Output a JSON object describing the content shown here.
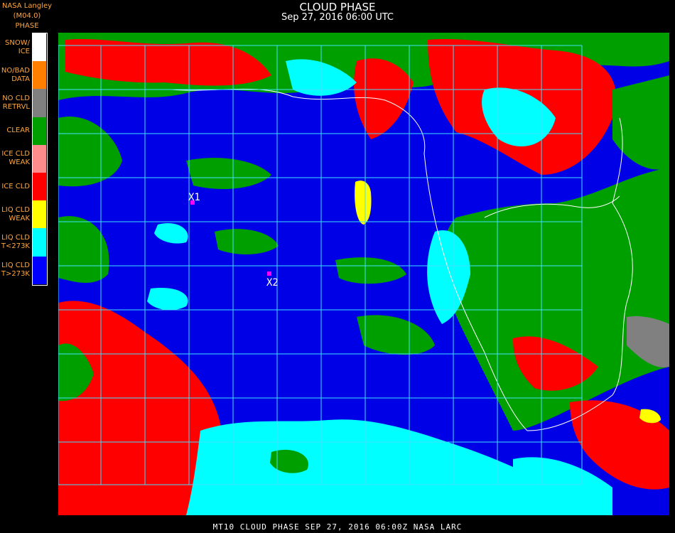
{
  "header": {
    "source": "NASA Langley (M04.0)",
    "legend_title": "PHASE",
    "title": "CLOUD PHASE",
    "subtitle": "Sep 27, 2016 06:00 UTC"
  },
  "legend": [
    {
      "label": "SNOW/\nICE",
      "color": "#ffffff"
    },
    {
      "label": "NO/BAD\nDATA",
      "color": "#ff8000"
    },
    {
      "label": "NO CLD\nRETRVL",
      "color": "#808080"
    },
    {
      "label": "CLEAR",
      "color": "#009f00"
    },
    {
      "label": "ICE CLD\nWEAK",
      "color": "#ff8c8c"
    },
    {
      "label": "ICE CLD",
      "color": "#ff0000"
    },
    {
      "label": "LIQ CLD\nWEAK",
      "color": "#ffff00"
    },
    {
      "label": "LIQ CLD\nT<273K",
      "color": "#00ffff"
    },
    {
      "label": "LIQ CLD\nT>273K",
      "color": "#0000ff"
    }
  ],
  "map": {
    "markers": [
      {
        "label": "X1",
        "color": "#ff00ff"
      },
      {
        "label": "X2",
        "color": "#ff00ff"
      }
    ],
    "colors": {
      "ocean": "#0000e6",
      "grid": "#40e0ff",
      "coast": "#ffffff"
    }
  },
  "footer": "MT10  CLOUD PHASE   SEP 27, 2016 06:00Z   NASA LARC"
}
